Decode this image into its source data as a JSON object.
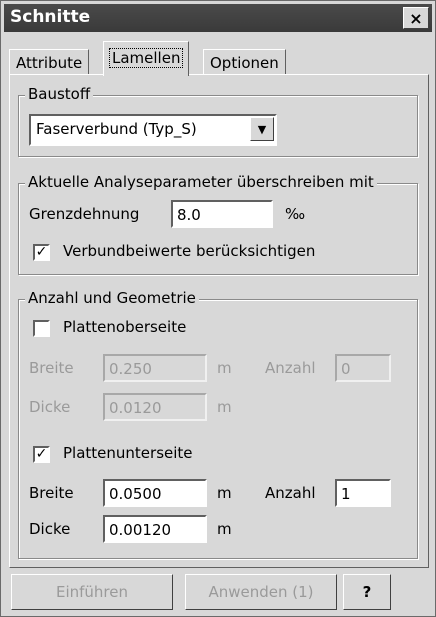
{
  "window": {
    "title": "Schnitte",
    "close_glyph": "×"
  },
  "tabs": [
    {
      "label": "Attribute"
    },
    {
      "label": "Lamellen",
      "active": true
    },
    {
      "label": "Optionen"
    }
  ],
  "baustoff": {
    "legend": "Baustoff",
    "selected": "Faserverbund (Typ_S)"
  },
  "analyse": {
    "legend": "Aktuelle Analyseparameter überschreiben mit",
    "grenzdehnung_label": "Grenzdehnung",
    "grenzdehnung_value": "8.0",
    "unit": "‰",
    "verbund_label": "Verbundbeiwerte berücksichtigen",
    "verbund_checked": true
  },
  "geometrie": {
    "legend": "Anzahl und Geometrie",
    "oben": {
      "label": "Plattenoberseite",
      "checked": false,
      "breite_label": "Breite",
      "breite_value": "0.250",
      "breite_unit": "m",
      "anzahl_label": "Anzahl",
      "anzahl_value": "0",
      "dicke_label": "Dicke",
      "dicke_value": "0.0120",
      "dicke_unit": "m"
    },
    "unten": {
      "label": "Plattenunterseite",
      "checked": true,
      "breite_label": "Breite",
      "breite_value": "0.0500",
      "breite_unit": "m",
      "anzahl_label": "Anzahl",
      "anzahl_value": "1",
      "dicke_label": "Dicke",
      "dicke_value": "0.00120",
      "dicke_unit": "m"
    }
  },
  "buttons": {
    "einfuehren": "Einführen",
    "anwenden": "Anwenden (1)",
    "help": "?"
  },
  "colors": {
    "titlebar": "#3f3f3f",
    "face": "#d8d8d8",
    "disabled_text": "#9a9a9a"
  }
}
